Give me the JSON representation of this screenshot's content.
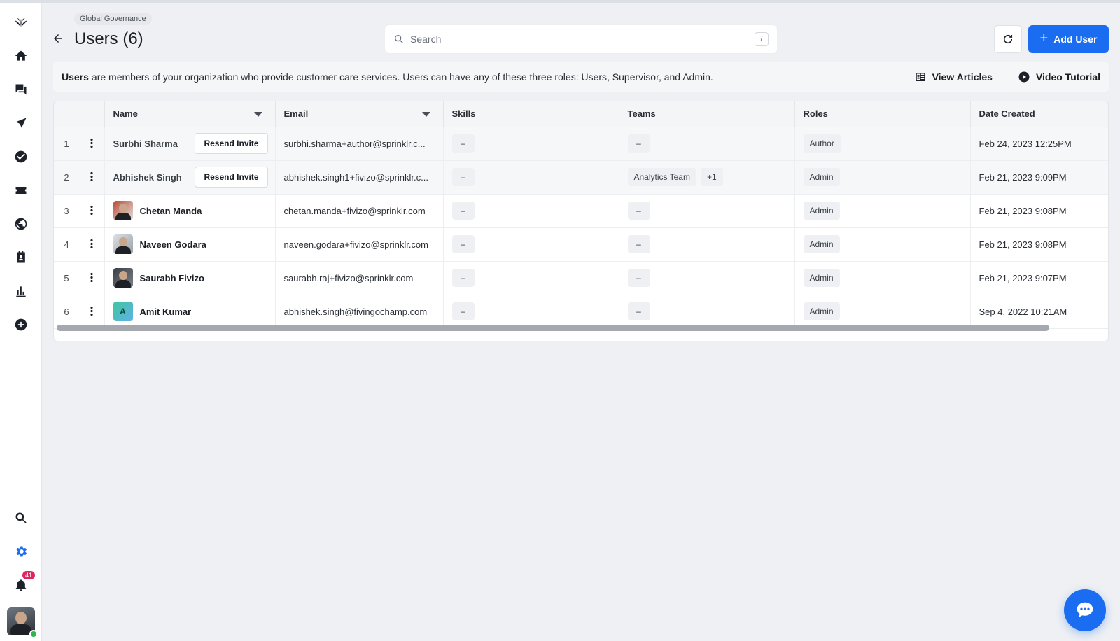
{
  "sidebar": {
    "notification_count": "41"
  },
  "header": {
    "breadcrumb": "Global Governance",
    "title": "Users (6)",
    "search_placeholder": "Search",
    "search_shortcut": "/",
    "add_user_label": "Add User"
  },
  "info": {
    "bold": "Users",
    "text": "are members of your organization who provide customer care services. Users can have any of these three roles: Users, Supervisor, and Admin.",
    "view_articles": "View Articles",
    "video_tutorial": "Video Tutorial"
  },
  "table": {
    "columns": {
      "name": "Name",
      "email": "Email",
      "skills": "Skills",
      "teams": "Teams",
      "roles": "Roles",
      "date_created": "Date Created"
    },
    "resend_label": "Resend Invite",
    "rows": [
      {
        "num": "1",
        "name": "Surbhi Sharma",
        "email": "surbhi.sharma+author@sprinklr.c...",
        "skills": "–",
        "teams": "–",
        "role": "Author",
        "date": "Feb 24, 2023 12:25PM",
        "pending": true
      },
      {
        "num": "2",
        "name": "Abhishek Singh",
        "email": "abhishek.singh1+fivizo@sprinklr.c...",
        "skills": "–",
        "team": "Analytics Team",
        "team_more": "+1",
        "role": "Admin",
        "date": "Feb 21, 2023 9:09PM",
        "pending": true
      },
      {
        "num": "3",
        "name": "Chetan Manda",
        "email": "chetan.manda+fivizo@sprinklr.com",
        "skills": "–",
        "teams": "–",
        "role": "Admin",
        "date": "Feb 21, 2023 9:08PM"
      },
      {
        "num": "4",
        "name": "Naveen Godara",
        "email": "naveen.godara+fivizo@sprinklr.com",
        "skills": "–",
        "teams": "–",
        "role": "Admin",
        "date": "Feb 21, 2023 9:08PM"
      },
      {
        "num": "5",
        "name": "Saurabh Fivizo",
        "email": "saurabh.raj+fivizo@sprinklr.com",
        "skills": "–",
        "teams": "–",
        "role": "Admin",
        "date": "Feb 21, 2023 9:07PM"
      },
      {
        "num": "6",
        "name": "Amit Kumar",
        "avatar_letter": "A",
        "email": "abhishek.singh@fivingochamp.com",
        "skills": "–",
        "teams": "–",
        "role": "Admin",
        "date": "Sep 4, 2022 10:21AM"
      }
    ]
  },
  "colors": {
    "accent": "#1a6cf0",
    "badge": "#e0245e",
    "online": "#2db84d"
  },
  "icons": [
    "logo-icon",
    "home-icon",
    "messages-icon",
    "send-icon",
    "check-circle-icon",
    "ticket-icon",
    "globe-icon",
    "contacts-icon",
    "bar-chart-icon",
    "add-circle-icon",
    "search-icon",
    "settings-icon",
    "bell-icon",
    "refresh-icon",
    "plus-icon",
    "book-icon",
    "play-icon",
    "chat-icon",
    "back-arrow-icon"
  ]
}
